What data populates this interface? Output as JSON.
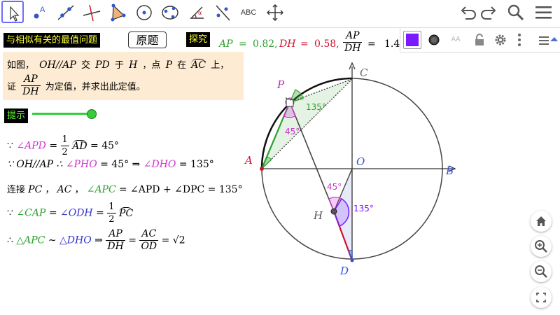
{
  "toolbar": {
    "tools": [
      {
        "name": "move",
        "active": true
      },
      {
        "name": "point"
      },
      {
        "name": "line"
      },
      {
        "name": "perpendicular"
      },
      {
        "name": "polygon"
      },
      {
        "name": "circle-center"
      },
      {
        "name": "conic"
      },
      {
        "name": "angle"
      },
      {
        "name": "reflect"
      },
      {
        "name": "text",
        "label": "ABC"
      },
      {
        "name": "move-view"
      }
    ],
    "right_icons": [
      "undo-icon",
      "redo-icon",
      "search-icon",
      "menu-icon"
    ]
  },
  "stylebar": {
    "color": "#7a1bff",
    "icons": [
      "color-swatch",
      "point-style-icon",
      "text-size-icon",
      "lock-icon",
      "gear-icon",
      "more-icon",
      "toggle-view-icon"
    ]
  },
  "header": {
    "title": "与相似有关的最值问题",
    "original_button": "原题",
    "explore": "探究"
  },
  "measurements": {
    "ap_label": "AP",
    "ap_value": "0.82,",
    "dh_label": "DH",
    "dh_value": "0.58,",
    "ratio_num": "AP",
    "ratio_den": "DH",
    "ratio_eq": "=",
    "ratio_value": "1.4",
    "ap_eq": "=",
    "dh_eq": "="
  },
  "problem": {
    "line1_a": "如图，",
    "line1_b": "OH//AP",
    "line1_c": "交",
    "line1_d": "PD",
    "line1_e": "于",
    "line1_f": "H",
    "line1_g": "，点",
    "line1_h": "P",
    "line1_i": "在",
    "line1_j": "AC",
    "line1_k": "上，",
    "line2_a": "证",
    "line2_num": "AP",
    "line2_den": "DH",
    "line2_b": "为定值，并求出此定值。"
  },
  "hint": {
    "label": "提示",
    "slider_value": 1.0,
    "slider_color": "#39cc39"
  },
  "proof": {
    "l1_a": "∵",
    "l1_b": "∠APD",
    "l1_c": "=",
    "l1_num": "1",
    "l1_den": "2",
    "l1_d": "AD",
    "l1_e": "= 45°",
    "l2_a": "∵ OH//AP ∴",
    "l2_b": "∠PHO",
    "l2_c": "= 45° ⇒",
    "l2_d": "∠DHO",
    "l2_e": "= 135°",
    "l3_a": "连接",
    "l3_b": "PC",
    "l3_c": "，",
    "l3_d": "AC",
    "l3_e": "，",
    "l3_f": "∠APC",
    "l3_g": "= ∠APD + ∠DPC = 135°",
    "l4_a": "∵",
    "l4_b": "∠CAP",
    "l4_c": "=",
    "l4_d": "∠ODH",
    "l4_e": "=",
    "l4_num": "1",
    "l4_den": "2",
    "l4_f": "PC",
    "l5_a": "∴",
    "l5_b": "△APC",
    "l5_c": "∼",
    "l5_d": "△DHO",
    "l5_e": "⇒",
    "l5_n1": "AP",
    "l5_d1": "DH",
    "l5_f": "=",
    "l5_n2": "AC",
    "l5_d2": "OD",
    "l5_g": "= √2"
  },
  "figure": {
    "points": {
      "A": "A",
      "B": "B",
      "C": "C",
      "D": "D",
      "O": "O",
      "P": "P",
      "H": "H"
    },
    "angles": {
      "p_top": "135°",
      "p_inner": "45°",
      "h_upper": "45°",
      "h_right": "135°"
    },
    "colors": {
      "green": "#2ca02c",
      "magenta": "#cc33cc",
      "blue": "#3355cc",
      "red": "#d01030",
      "circle": "#444444"
    }
  },
  "zoom": {
    "buttons": [
      "home-icon",
      "zoom-in-icon",
      "zoom-out-icon",
      "fullscreen-icon"
    ]
  }
}
